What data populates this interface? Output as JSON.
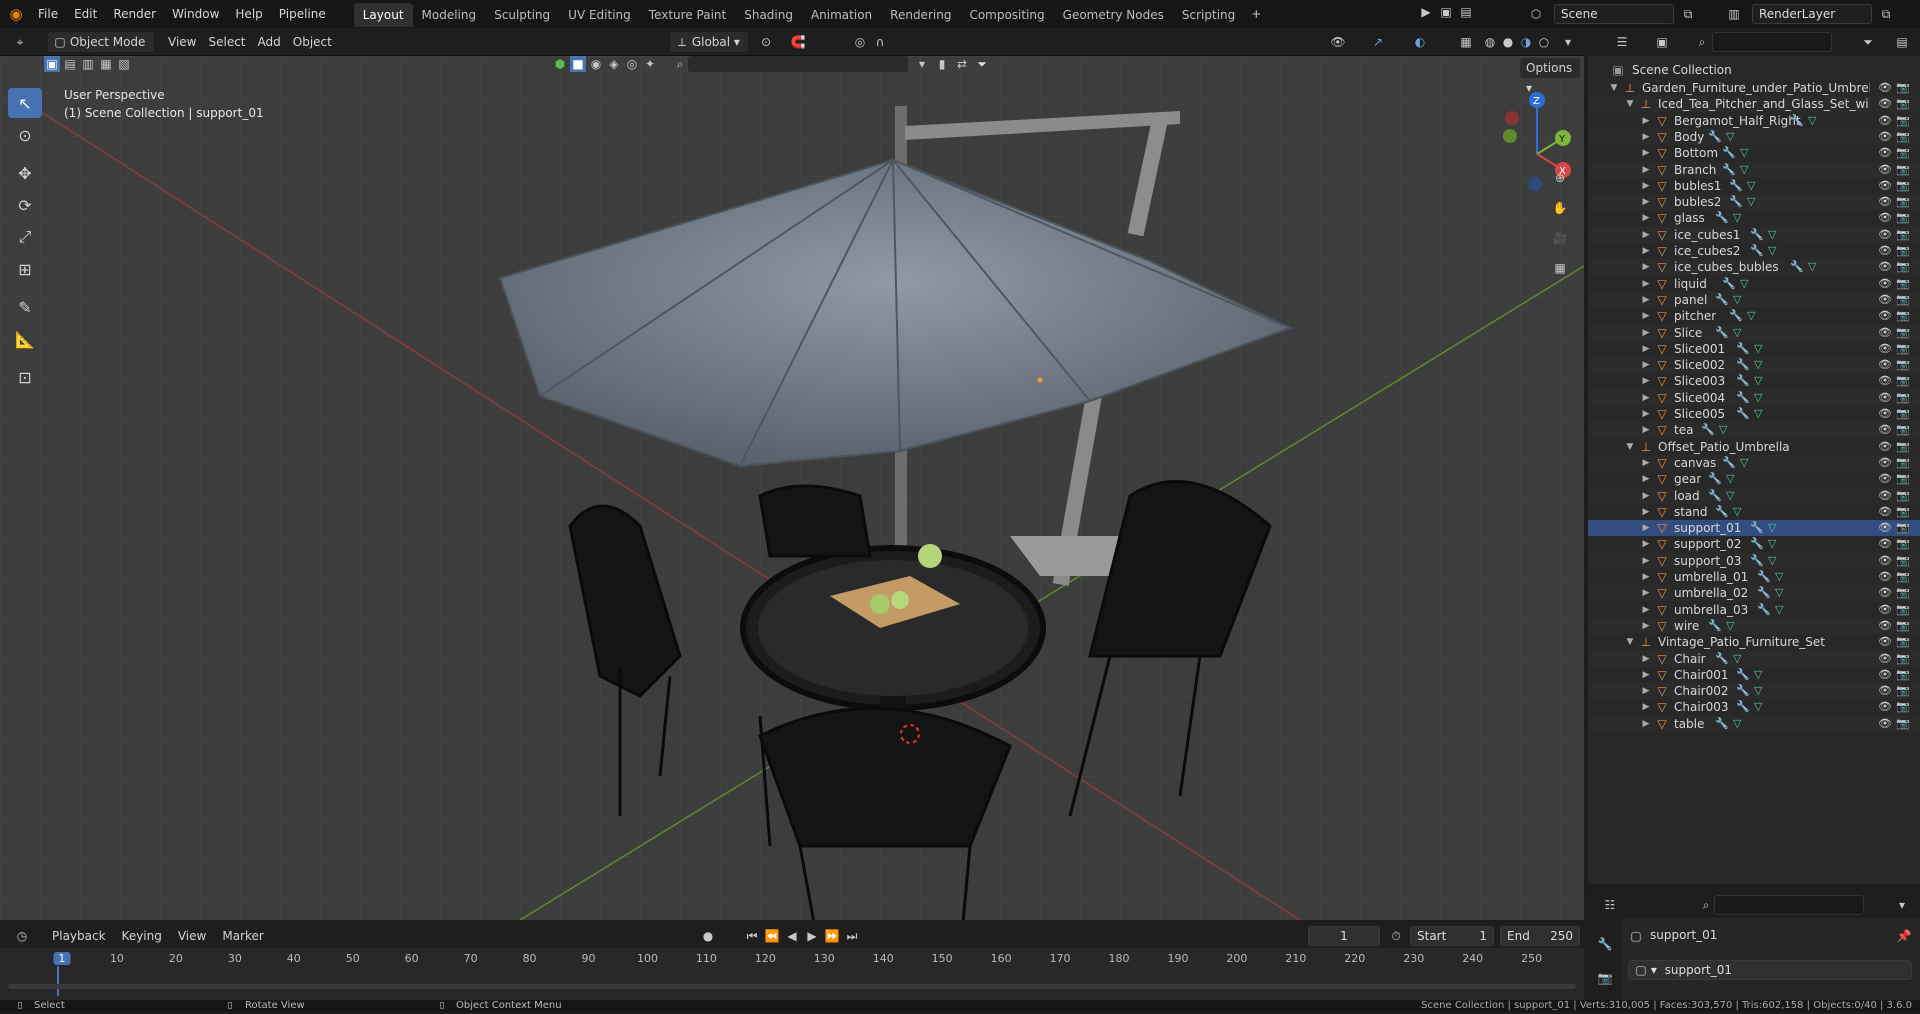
{
  "topbar": {
    "menus": [
      "File",
      "Edit",
      "Render",
      "Window",
      "Help",
      "Pipeline"
    ],
    "workspaces": [
      "Layout",
      "Modeling",
      "Sculpting",
      "UV Editing",
      "Texture Paint",
      "Shading",
      "Animation",
      "Rendering",
      "Compositing",
      "Geometry Nodes",
      "Scripting"
    ],
    "active_workspace": "Layout",
    "scene_name": "Scene",
    "view_layer": "RenderLayer"
  },
  "viewport_header": {
    "mode": "Object Mode",
    "menus": [
      "View",
      "Select",
      "Add",
      "Object"
    ],
    "orientation": "Global",
    "options_label": "Options"
  },
  "viewport": {
    "view_name": "User Perspective",
    "context": "(1) Scene Collection | support_01"
  },
  "outliner": {
    "root": "Scene Collection",
    "rows": [
      {
        "label": "Garden_Furniture_under_Patio_Umbrella",
        "kind": "empty",
        "level": 1,
        "expanded": true
      },
      {
        "label": "Iced_Tea_Pitcher_and_Glass_Set_wi",
        "kind": "empty",
        "level": 2,
        "expanded": true
      },
      {
        "label": "Bergamot_Half_Right",
        "kind": "mesh",
        "level": 3
      },
      {
        "label": "Body",
        "kind": "mesh",
        "level": 3
      },
      {
        "label": "Bottom",
        "kind": "mesh",
        "level": 3
      },
      {
        "label": "Branch",
        "kind": "mesh",
        "level": 3
      },
      {
        "label": "bubles1",
        "kind": "mesh",
        "level": 3
      },
      {
        "label": "bubles2",
        "kind": "mesh",
        "level": 3
      },
      {
        "label": "glass",
        "kind": "mesh",
        "level": 3
      },
      {
        "label": "ice_cubes1",
        "kind": "mesh",
        "level": 3
      },
      {
        "label": "ice_cubes2",
        "kind": "mesh",
        "level": 3
      },
      {
        "label": "ice_cubes_bubles",
        "kind": "mesh",
        "level": 3
      },
      {
        "label": "liquid",
        "kind": "mesh",
        "level": 3
      },
      {
        "label": "panel",
        "kind": "mesh",
        "level": 3
      },
      {
        "label": "pitcher",
        "kind": "mesh",
        "level": 3
      },
      {
        "label": "Slice",
        "kind": "mesh",
        "level": 3
      },
      {
        "label": "Slice001",
        "kind": "mesh",
        "level": 3
      },
      {
        "label": "Slice002",
        "kind": "mesh",
        "level": 3
      },
      {
        "label": "Slice003",
        "kind": "mesh",
        "level": 3
      },
      {
        "label": "Slice004",
        "kind": "mesh",
        "level": 3
      },
      {
        "label": "Slice005",
        "kind": "mesh",
        "level": 3
      },
      {
        "label": "tea",
        "kind": "mesh",
        "level": 3
      },
      {
        "label": "Offset_Patio_Umbrella",
        "kind": "empty",
        "level": 2,
        "expanded": true
      },
      {
        "label": "canvas",
        "kind": "mesh",
        "level": 3
      },
      {
        "label": "gear",
        "kind": "mesh",
        "level": 3
      },
      {
        "label": "load",
        "kind": "mesh",
        "level": 3
      },
      {
        "label": "stand",
        "kind": "mesh",
        "level": 3
      },
      {
        "label": "support_01",
        "kind": "mesh",
        "level": 3,
        "selected": true
      },
      {
        "label": "support_02",
        "kind": "mesh",
        "level": 3
      },
      {
        "label": "support_03",
        "kind": "mesh",
        "level": 3
      },
      {
        "label": "umbrella_01",
        "kind": "mesh",
        "level": 3
      },
      {
        "label": "umbrella_02",
        "kind": "mesh",
        "level": 3
      },
      {
        "label": "umbrella_03",
        "kind": "mesh",
        "level": 3
      },
      {
        "label": "wire",
        "kind": "mesh",
        "level": 3
      },
      {
        "label": "Vintage_Patio_Furniture_Set",
        "kind": "empty",
        "level": 2,
        "expanded": true
      },
      {
        "label": "Chair",
        "kind": "mesh",
        "level": 3
      },
      {
        "label": "Chair001",
        "kind": "mesh",
        "level": 3
      },
      {
        "label": "Chair002",
        "kind": "mesh",
        "level": 3
      },
      {
        "label": "Chair003",
        "kind": "mesh",
        "level": 3
      },
      {
        "label": "table",
        "kind": "mesh",
        "level": 3
      }
    ]
  },
  "properties": {
    "object_name": "support_01",
    "data_name": "support_01"
  },
  "timeline": {
    "menus": [
      "Playback",
      "Keying",
      "View",
      "Marker"
    ],
    "current_frame": "1",
    "start_label": "Start",
    "start": "1",
    "end_label": "End",
    "end": "250",
    "ticks": [
      "1",
      "10",
      "20",
      "30",
      "40",
      "50",
      "60",
      "70",
      "80",
      "90",
      "100",
      "110",
      "120",
      "130",
      "140",
      "150",
      "160",
      "170",
      "180",
      "190",
      "200",
      "210",
      "220",
      "230",
      "240",
      "250"
    ]
  },
  "statusbar": {
    "left": "Select",
    "middle": "Rotate View",
    "right": "Object Context Menu",
    "stats": "Scene Collection | support_01 | Verts:310,005 | Faces:303,570 | Tris:602,158 | Objects:0/40 | 3.6.0"
  }
}
